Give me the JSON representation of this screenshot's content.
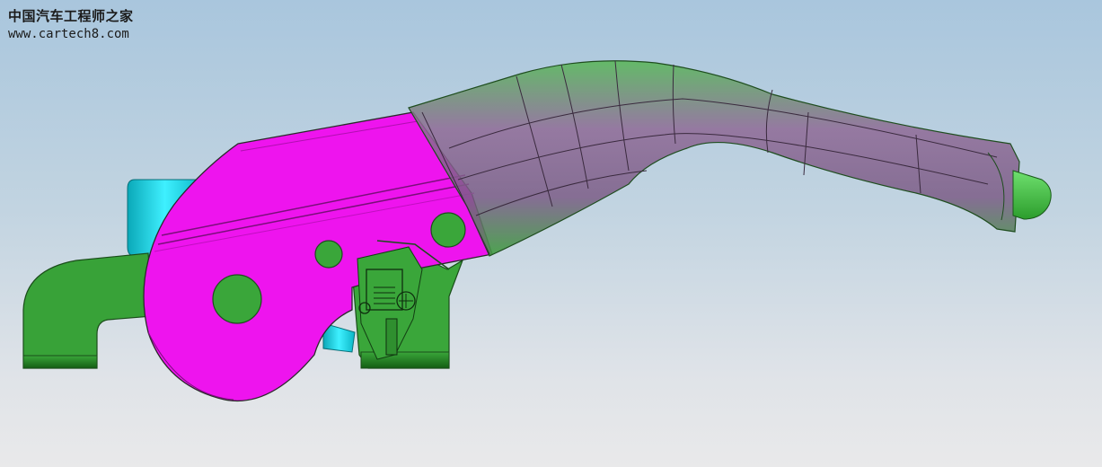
{
  "watermark": {
    "title": "中国汽车工程师之家",
    "url": "www.cartech8.com"
  },
  "colors": {
    "magenta": "#ee14ee",
    "green": "#3aa63a",
    "dark_green": "#1f6f1f",
    "cyan": "#22e4f0",
    "translucent_green": "#4fb04f",
    "translucent_purple": "#8a5f8f"
  }
}
